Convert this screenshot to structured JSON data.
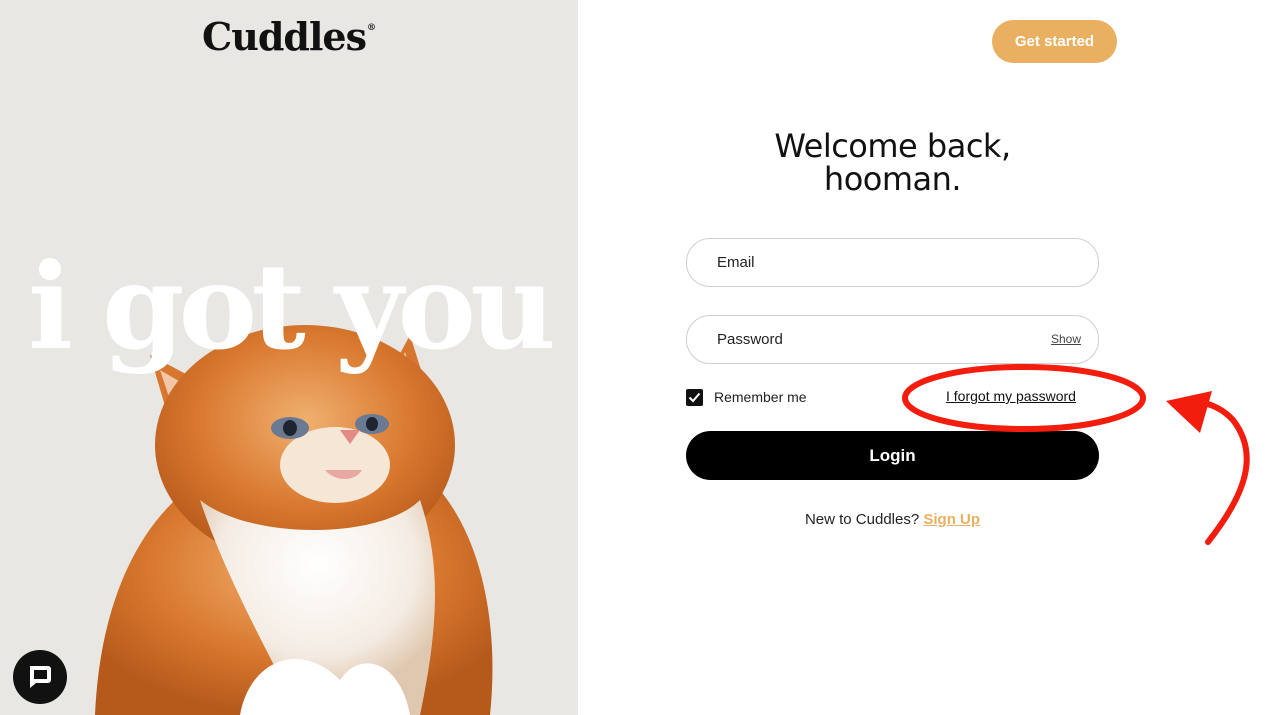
{
  "brand": {
    "logo_text": "Cuddles",
    "logo_mark": "®",
    "hero_text": "i got you"
  },
  "header": {
    "cta_label": "Get started"
  },
  "login": {
    "heading_line1": "Welcome back,",
    "heading_line2": "hooman.",
    "email_placeholder": "Email",
    "email_value": "",
    "password_placeholder": "Password",
    "password_value": "",
    "show_label": "Show",
    "remember_label": "Remember me",
    "remember_checked": true,
    "forgot_label": "I forgot my password",
    "submit_label": "Login",
    "signup_prompt": "New to Cuddles?",
    "signup_label": "Sign Up"
  },
  "icons": {
    "chat": "chat-bubble-icon",
    "checkbox": "checkmark-icon",
    "annotation_circle": "red-circle-highlight",
    "annotation_arrow": "red-curved-arrow"
  },
  "colors": {
    "accent": "#e9b062",
    "primary_button": "#000000",
    "hero_background": "#e9e7e3",
    "annotation": "#f21d0c"
  }
}
